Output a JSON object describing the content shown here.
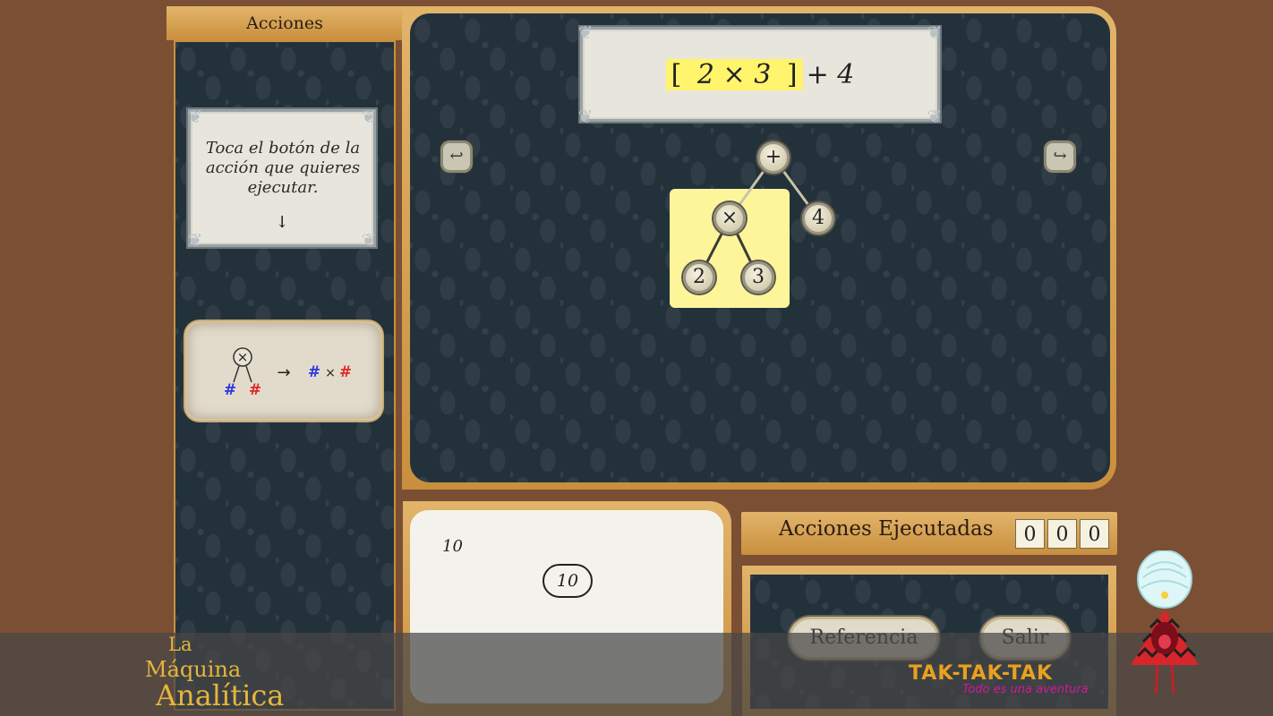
{
  "left_panel": {
    "title": "Acciones"
  },
  "instruction": {
    "text": "Toca el botón de la acción que quieres ejecutar.",
    "arrow": "↓"
  },
  "action_rule": {
    "node_symbol": "×",
    "left_operand": "#",
    "right_operand": "#",
    "arrow": "→",
    "result_left": "#",
    "result_op": "×",
    "result_right": "#",
    "colors": {
      "left": "#2b36e0",
      "right": "#e02a2a"
    }
  },
  "expression": {
    "open_bracket": "[",
    "highlighted": "2 × 3",
    "close_bracket": "]",
    "rest": "+ 4"
  },
  "nav": {
    "undo_icon": "undo-arrow-icon",
    "redo_icon": "redo-arrow-icon",
    "undo_glyph": "↩",
    "redo_glyph": "↪"
  },
  "tree": {
    "root": "+",
    "mul": "×",
    "right_leaf": "4",
    "leaf_left": "2",
    "leaf_right": "3"
  },
  "result": {
    "value_small": "10",
    "value_pill": "10"
  },
  "executed": {
    "title": "Acciones Ejecutadas",
    "digits": [
      "0",
      "0",
      "0"
    ]
  },
  "buttons": {
    "reference": "Referencia",
    "exit": "Salir"
  },
  "logo": {
    "line1": "La",
    "line2": "Máquina",
    "line3": "Analítica"
  },
  "brand": {
    "title": "TAK-TAK-TAK",
    "subtitle": "Todo es una aventura"
  },
  "colors": {
    "gold": "#d9a552",
    "board": "#23313b",
    "highlight": "#fff46b",
    "logo": "#e6b53c"
  }
}
